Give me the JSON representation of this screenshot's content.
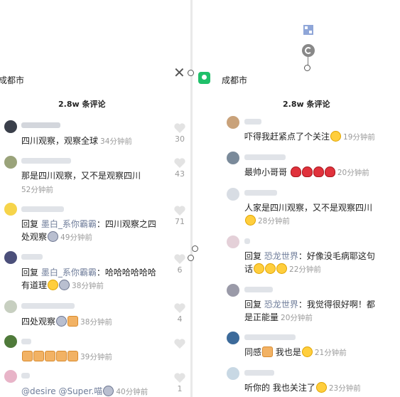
{
  "left": {
    "location": "成都市",
    "comment_count": "2.8w 条评论",
    "comments": [
      {
        "text": "四川观察，观察全球",
        "time": "34分钟前",
        "likes": "30",
        "avatar_color": "#3a3f4a"
      },
      {
        "text": "那是四川观察，又不是观察四川",
        "time": "52分钟前",
        "likes": "43",
        "avatar_color": "#9aa37a"
      },
      {
        "reply_prefix": "回复 ",
        "reply_to": "墨白_系你霸霸",
        "text_line1": "：四川观察之四",
        "text_line2": "处观察",
        "time": "49分钟前",
        "likes": "71",
        "avatar_color": "#f6d44a"
      },
      {
        "reply_prefix": "回复 ",
        "reply_to": "墨白_系你霸霸",
        "text_line1": "：哈哈哈哈哈哈",
        "text_line2": "有道理",
        "time": "38分钟前",
        "likes": "6",
        "avatar_color": "#4b4f7a"
      },
      {
        "text": "四处观察",
        "time": "38分钟前",
        "likes": "4",
        "avatar_color": "#c7cfc0"
      },
      {
        "text": "",
        "time": "39分钟前",
        "likes": "",
        "avatar_color": "#4f7a3a"
      },
      {
        "text": "@desire @Super.喵",
        "time": "40分钟前",
        "likes": "1",
        "avatar_color": "#e8b4c8"
      }
    ]
  },
  "right": {
    "location": "成都市",
    "comment_count": "2.8w 条评论",
    "comments": [
      {
        "text": "吓得我赶紧点了个关注",
        "time": "19分钟前",
        "avatar_color": "#c9a27a"
      },
      {
        "text": "最帅小哥哥",
        "time": "20分钟前",
        "avatar_color": "#7a8a9a"
      },
      {
        "text_line1": "人家是四川观察，又不是观察四川",
        "text_line2": "",
        "time": "28分钟前",
        "avatar_color": "#d8dde4"
      },
      {
        "reply_prefix": "回复 ",
        "reply_to": "恐龙世界",
        "text_line1": "：好像没毛病耶这句",
        "text_line2": "话",
        "time": "22分钟前",
        "avatar_color": "#e4d0d8"
      },
      {
        "reply_prefix": "回复 ",
        "reply_to": "恐龙世界",
        "text_line1": "：我觉得很好啊！都",
        "text_line2": "是正能量",
        "time": "20分钟前",
        "avatar_color": "#9a9aa8"
      },
      {
        "text": "同感",
        "text_mid": " 我也是",
        "time": "21分钟前",
        "avatar_color": "#3c6a9a"
      },
      {
        "text": "听你的 我也关注了",
        "time": "23分钟前",
        "avatar_color": "#c8d8e4"
      }
    ]
  },
  "colors": {
    "accent": "#20c06a",
    "reply_name": "#6f7d9a",
    "muted": "#9a9a9a"
  },
  "icons": [
    "close-icon",
    "location-pin-icon",
    "heart-icon",
    "rotate-handle-icon",
    "qr-icon"
  ]
}
